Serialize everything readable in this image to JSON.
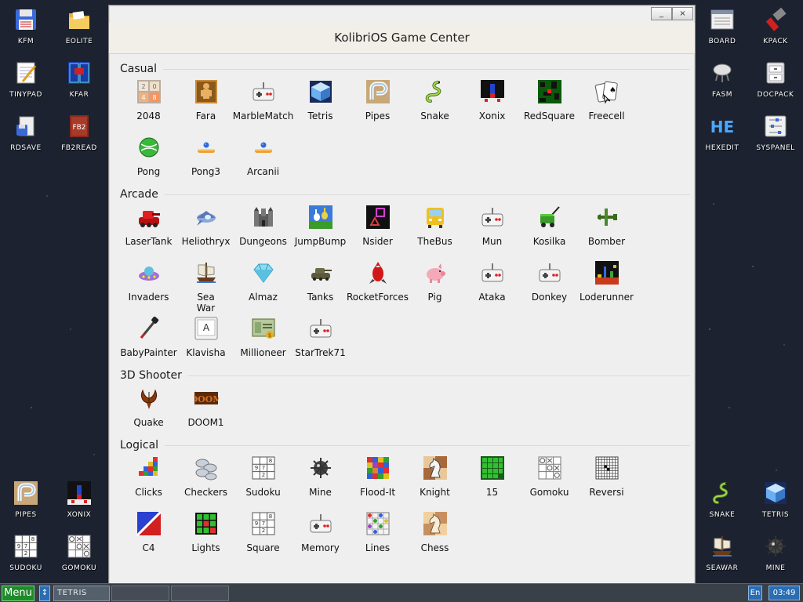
{
  "window": {
    "title": "KolibriOS Game Center",
    "minimize_glyph": "_",
    "close_glyph": "×"
  },
  "desktop_left": [
    {
      "label": "KFM",
      "icon": "floppy-icon"
    },
    {
      "label": "EOLITE",
      "icon": "folder-icon"
    },
    {
      "label": "TINYPAD",
      "icon": "notepad-icon"
    },
    {
      "label": "KFAR",
      "icon": "kfar-icon"
    },
    {
      "label": "RDSAVE",
      "icon": "rdsave-icon"
    },
    {
      "label": "FB2READ",
      "icon": "book-icon"
    },
    {
      "label": "PIPES",
      "icon": "pipes-icon"
    },
    {
      "label": "XONIX",
      "icon": "xonix-icon"
    },
    {
      "label": "SUDOKU",
      "icon": "sudoku-icon"
    },
    {
      "label": "GOMOKU",
      "icon": "gomoku-icon"
    }
  ],
  "desktop_right": [
    {
      "label": "BOARD",
      "icon": "board-icon"
    },
    {
      "label": "KPACK",
      "icon": "kpack-icon"
    },
    {
      "label": "FASM",
      "icon": "fasm-icon"
    },
    {
      "label": "DOCPACK",
      "icon": "docpack-icon"
    },
    {
      "label": "HEXEDIT",
      "icon": "hexedit-icon"
    },
    {
      "label": "SYSPANEL",
      "icon": "syspanel-icon"
    },
    {
      "label": "SNAKE",
      "icon": "snake-icon"
    },
    {
      "label": "TETRIS",
      "icon": "tetris-icon"
    },
    {
      "label": "SEAWAR",
      "icon": "seawar-icon"
    },
    {
      "label": "MINE",
      "icon": "mine-icon"
    }
  ],
  "sections": [
    {
      "title": "Casual",
      "games": [
        {
          "label": "2048",
          "icon": "2048"
        },
        {
          "label": "Fara",
          "icon": "fara"
        },
        {
          "label": "MarbleMatch",
          "icon": "gamepad"
        },
        {
          "label": "Tetris",
          "icon": "tetris"
        },
        {
          "label": "Pipes",
          "icon": "pipes"
        },
        {
          "label": "Snake",
          "icon": "snake"
        },
        {
          "label": "Xonix",
          "icon": "xonix"
        },
        {
          "label": "RedSquare",
          "icon": "redsquare"
        },
        {
          "label": "Freecell",
          "icon": "cards"
        },
        {
          "label": "Pong",
          "icon": "pong"
        },
        {
          "label": "Pong3",
          "icon": "paddle"
        },
        {
          "label": "Arcanii",
          "icon": "paddle"
        }
      ]
    },
    {
      "title": "Arcade",
      "games": [
        {
          "label": "LaserTank",
          "icon": "lasertank"
        },
        {
          "label": "Heliothryx",
          "icon": "heliothryx"
        },
        {
          "label": "Dungeons",
          "icon": "dungeons"
        },
        {
          "label": "JumpBump",
          "icon": "jumpbump"
        },
        {
          "label": "Nsider",
          "icon": "nsider"
        },
        {
          "label": "TheBus",
          "icon": "thebus"
        },
        {
          "label": "Mun",
          "icon": "gamepad"
        },
        {
          "label": "Kosilka",
          "icon": "kosilka"
        },
        {
          "label": "Bomber",
          "icon": "bomber"
        },
        {
          "label": "Invaders",
          "icon": "invaders"
        },
        {
          "label": "Sea War",
          "icon": "seawar"
        },
        {
          "label": "Almaz",
          "icon": "almaz"
        },
        {
          "label": "Tanks",
          "icon": "tanks"
        },
        {
          "label": "RocketForces",
          "icon": "rocket"
        },
        {
          "label": "Pig",
          "icon": "pig"
        },
        {
          "label": "Ataka",
          "icon": "gamepad"
        },
        {
          "label": "Donkey",
          "icon": "gamepad"
        },
        {
          "label": "Loderunner",
          "icon": "loderunner"
        },
        {
          "label": "BabyPainter",
          "icon": "babypainter"
        },
        {
          "label": "Klavisha",
          "icon": "klavisha"
        },
        {
          "label": "Millioneer",
          "icon": "millioneer"
        },
        {
          "label": "StarTrek71",
          "icon": "gamepad"
        }
      ]
    },
    {
      "title": "3D Shooter",
      "games": [
        {
          "label": "Quake",
          "icon": "quake"
        },
        {
          "label": "DOOM1",
          "icon": "doom"
        }
      ]
    },
    {
      "title": "Logical",
      "games": [
        {
          "label": "Clicks",
          "icon": "clicks"
        },
        {
          "label": "Checkers",
          "icon": "checkers"
        },
        {
          "label": "Sudoku",
          "icon": "sudoku"
        },
        {
          "label": "Mine",
          "icon": "mine"
        },
        {
          "label": "Flood-It",
          "icon": "floodit"
        },
        {
          "label": "Knight",
          "icon": "knight"
        },
        {
          "label": "15",
          "icon": "fifteen"
        },
        {
          "label": "Gomoku",
          "icon": "gomoku"
        },
        {
          "label": "Reversi",
          "icon": "reversi"
        },
        {
          "label": "C4",
          "icon": "c4"
        },
        {
          "label": "Lights",
          "icon": "lights"
        },
        {
          "label": "Square",
          "icon": "sudoku"
        },
        {
          "label": "Memory",
          "icon": "gamepad"
        },
        {
          "label": "Lines",
          "icon": "lines"
        },
        {
          "label": "Chess",
          "icon": "chess"
        }
      ]
    }
  ],
  "taskbar": {
    "menu_label": "Menu",
    "arrow_glyph": "↕",
    "active_task": "TETRIS",
    "lang": "En",
    "clock": "03:49"
  },
  "colors": {
    "desktop_bg": "#1c2230",
    "window_bg": "#efefef",
    "menu_green": "#1f8a2a",
    "taskbar_blue": "#2a6db3"
  }
}
